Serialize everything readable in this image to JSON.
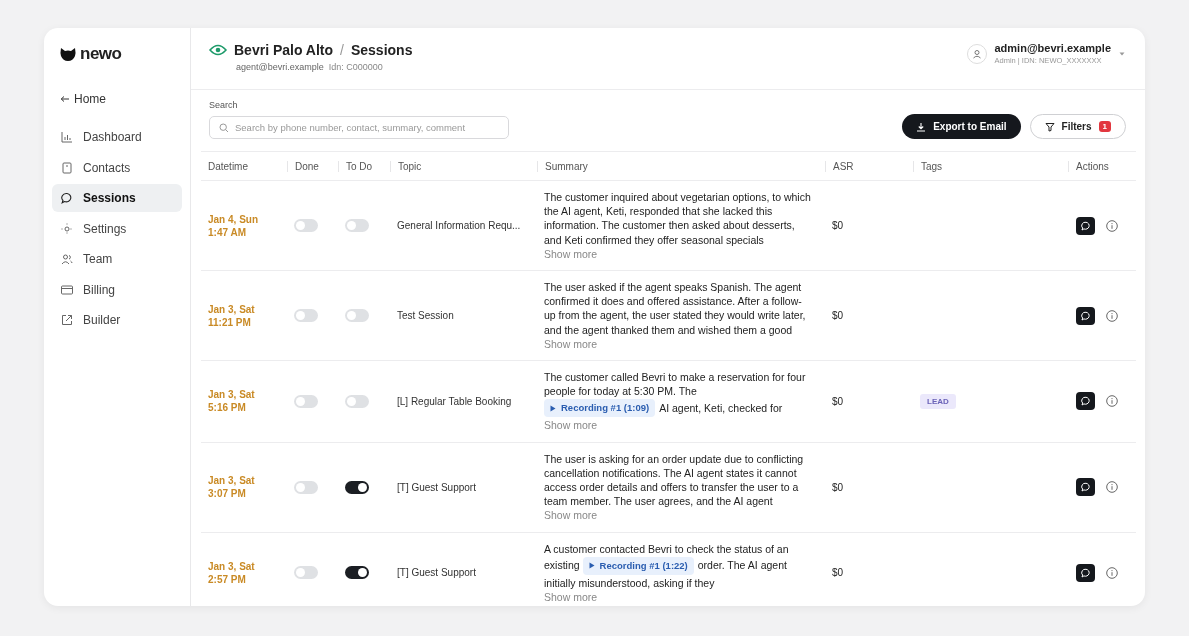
{
  "sidebar": {
    "logo": "newo",
    "home": "Home",
    "items": [
      {
        "label": "Dashboard",
        "selected": false
      },
      {
        "label": "Contacts",
        "selected": false
      },
      {
        "label": "Sessions",
        "selected": true
      },
      {
        "label": "Settings",
        "selected": false
      },
      {
        "label": "Team",
        "selected": false
      },
      {
        "label": "Billing",
        "selected": false
      },
      {
        "label": "Builder",
        "selected": false
      }
    ]
  },
  "header": {
    "title": "Bevri Palo Alto",
    "separator": "/",
    "page": "Sessions",
    "agent": "agent@bevri.example",
    "idn": "Idn: C000000",
    "user": {
      "email": "admin@bevri.example",
      "role": "Admin | IDN: NEWO_XXXXXXX"
    }
  },
  "search": {
    "label": "Search",
    "placeholder": "Search by phone number, contact, summary, comment"
  },
  "actions": {
    "export": "Export to Email",
    "filters": "Filters",
    "filter_count": "1"
  },
  "table": {
    "columns": [
      "Datetime",
      "Done",
      "To Do",
      "Topic",
      "Summary",
      "ASR",
      "Tags",
      "Actions"
    ],
    "rows": [
      {
        "date": "Jan 4, Sun",
        "time": "1:47 AM",
        "done": false,
        "todo": false,
        "topic": "General Information Requ...",
        "summary": [
          {
            "kind": "text",
            "text": "The customer inquired about vegetarian options, to which the AI agent, Keti, responded that she lacked this information. The customer then asked about desserts, and Keti confirmed they offer seasonal specials"
          }
        ],
        "show_more": "Show more",
        "asr": "$0",
        "tags": []
      },
      {
        "date": "Jan 3, Sat",
        "time": "11:21 PM",
        "done": false,
        "todo": false,
        "topic": "Test Session",
        "summary": [
          {
            "kind": "text",
            "text": "The user asked if the agent speaks Spanish. The agent confirmed it does and offered assistance. After a follow-up from the agent, the user stated they would write later, and the agent thanked them and wished them a good"
          }
        ],
        "show_more": "Show more",
        "asr": "$0",
        "tags": []
      },
      {
        "date": "Jan 3, Sat",
        "time": "5:16 PM",
        "done": false,
        "todo": false,
        "topic": "[L] Regular Table Booking",
        "summary": [
          {
            "kind": "text",
            "text": "The customer called Bevri to make a reservation for four people for today at 5:30 PM. The"
          },
          {
            "kind": "recording",
            "text": "Recording #1 (1:09)"
          },
          {
            "kind": "text",
            "text": "AI agent, Keti, checked for"
          }
        ],
        "show_more": "Show more",
        "asr": "$0",
        "tags": [
          "LEAD"
        ]
      },
      {
        "date": "Jan 3, Sat",
        "time": "3:07 PM",
        "done": false,
        "todo": true,
        "topic": "[T] Guest Support",
        "summary": [
          {
            "kind": "text",
            "text": "The user is asking for an order update due to conflicting cancellation notifications. The AI agent states it cannot access order details and offers to transfer the user to a team member. The user agrees, and the AI agent"
          }
        ],
        "show_more": "Show more",
        "asr": "$0",
        "tags": []
      },
      {
        "date": "Jan 3, Sat",
        "time": "2:57 PM",
        "done": false,
        "todo": true,
        "topic": "[T] Guest Support",
        "summary": [
          {
            "kind": "text",
            "text": "A customer contacted Bevri to check the status of an existing"
          },
          {
            "kind": "recording",
            "text": "Recording #1 (1:22)"
          },
          {
            "kind": "text",
            "text": "order. The AI agent initially misunderstood, asking if they"
          }
        ],
        "show_more": "Show more",
        "asr": "$0",
        "tags": []
      }
    ]
  }
}
